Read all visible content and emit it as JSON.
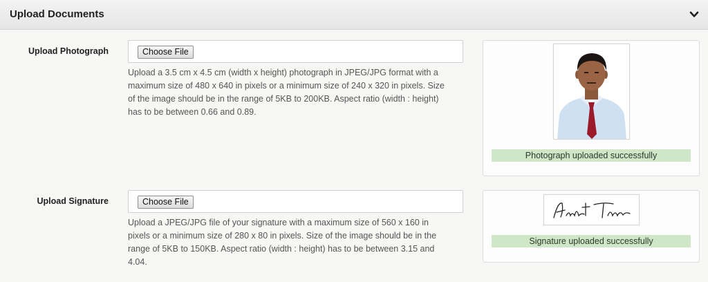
{
  "header": {
    "title": "Upload Documents",
    "toggle_icon": "chevron-down-icon"
  },
  "photo": {
    "label": "Upload Photograph",
    "button_label": "Choose File",
    "help_lines": [
      "Upload a 3.5 cm x 4.5 cm (width x height) photograph in JPEG/JPG format with a",
      "maximum size of 480 x 640 in pixels or a minimum size of 240 x 320 in pixels. Size",
      "of the image should be in the range of 5KB to 200KB. Aspect ratio (width : height)",
      "has to be between 0.66 and 0.89."
    ],
    "status": "Photograph uploaded successfully"
  },
  "signature": {
    "label": "Upload Signature",
    "button_label": "Choose File",
    "help_lines": [
      "Upload a JPEG/JPG file of your signature with a maximum size of 560 x 160 in",
      "pixels or a minimum size of 280 x 80 in pixels. Size of the image should be in the",
      "range of 5KB to 150KB. Aspect ratio (width : height) has to be between 3.15 and",
      "4.04."
    ],
    "signature_text": "Ankit Thakur",
    "status": "Signature uploaded successfully"
  },
  "colors": {
    "header_bg": "#e9e9e9",
    "status_bg": "#cfe6c7",
    "tie": "#9b1b2a",
    "shirt": "#cfe0f2"
  }
}
